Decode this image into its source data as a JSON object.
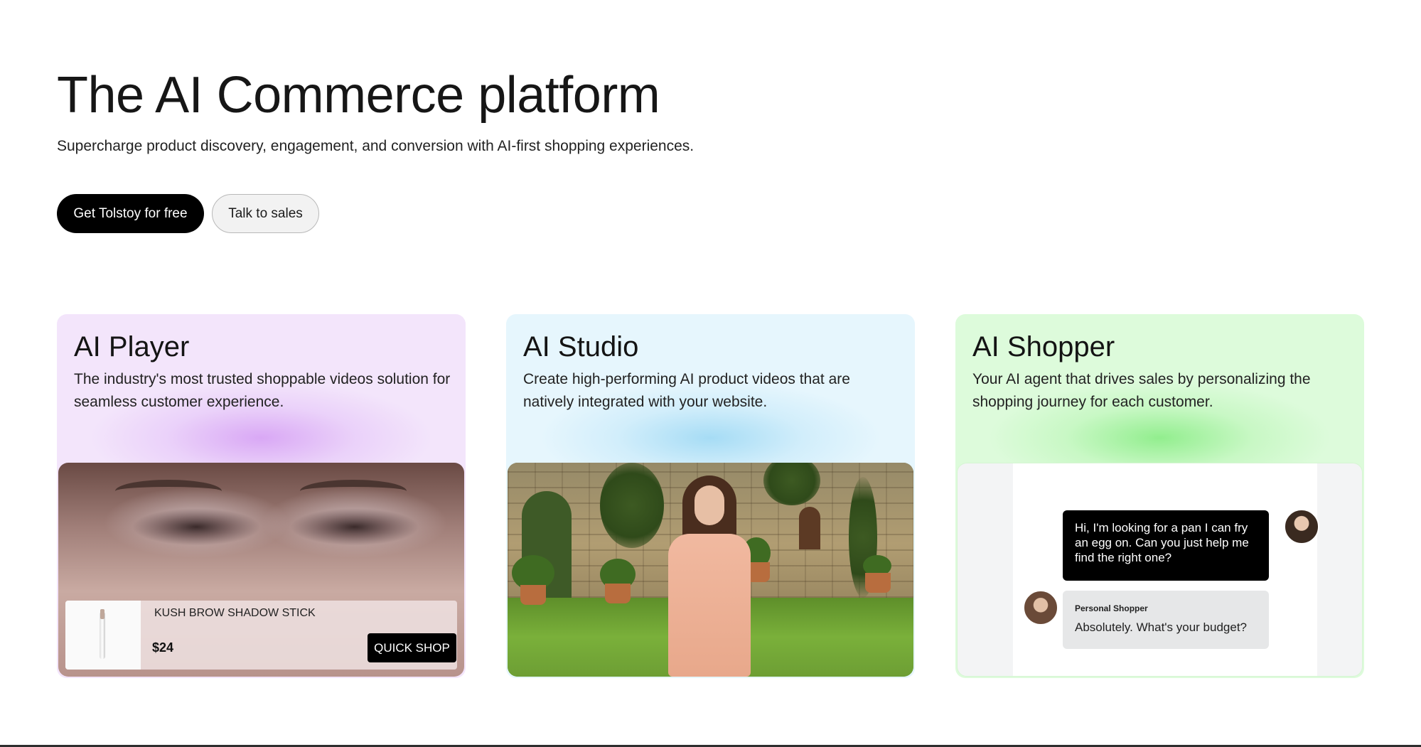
{
  "hero": {
    "title": "The AI Commerce platform",
    "subtitle": "Supercharge product discovery, engagement, and conversion with AI-first shopping experiences."
  },
  "ctas": {
    "primary": "Get Tolstoy for free",
    "secondary": "Talk to sales"
  },
  "cards": [
    {
      "title": "AI Player",
      "description": "The industry's most trusted shoppable videos solution for seamless customer experience.",
      "accent": "#f3e5fb",
      "product": {
        "name": "KUSH BROW SHADOW STICK",
        "price": "$24",
        "cta": "QUICK SHOP"
      }
    },
    {
      "title": "AI Studio",
      "description": "Create high-performing AI product videos that are natively integrated with your website.",
      "accent": "#e6f6fd"
    },
    {
      "title": "AI Shopper",
      "description": "Your AI agent that drives sales by personalizing the shopping journey for each customer.",
      "accent": "#ddfbdb",
      "chat": {
        "user_message": "Hi, I'm looking for a pan I can fry an egg on. Can you just help me find the right one?",
        "bot_name": "Personal Shopper",
        "bot_message": "Absolutely. What's your budget?"
      }
    }
  ]
}
